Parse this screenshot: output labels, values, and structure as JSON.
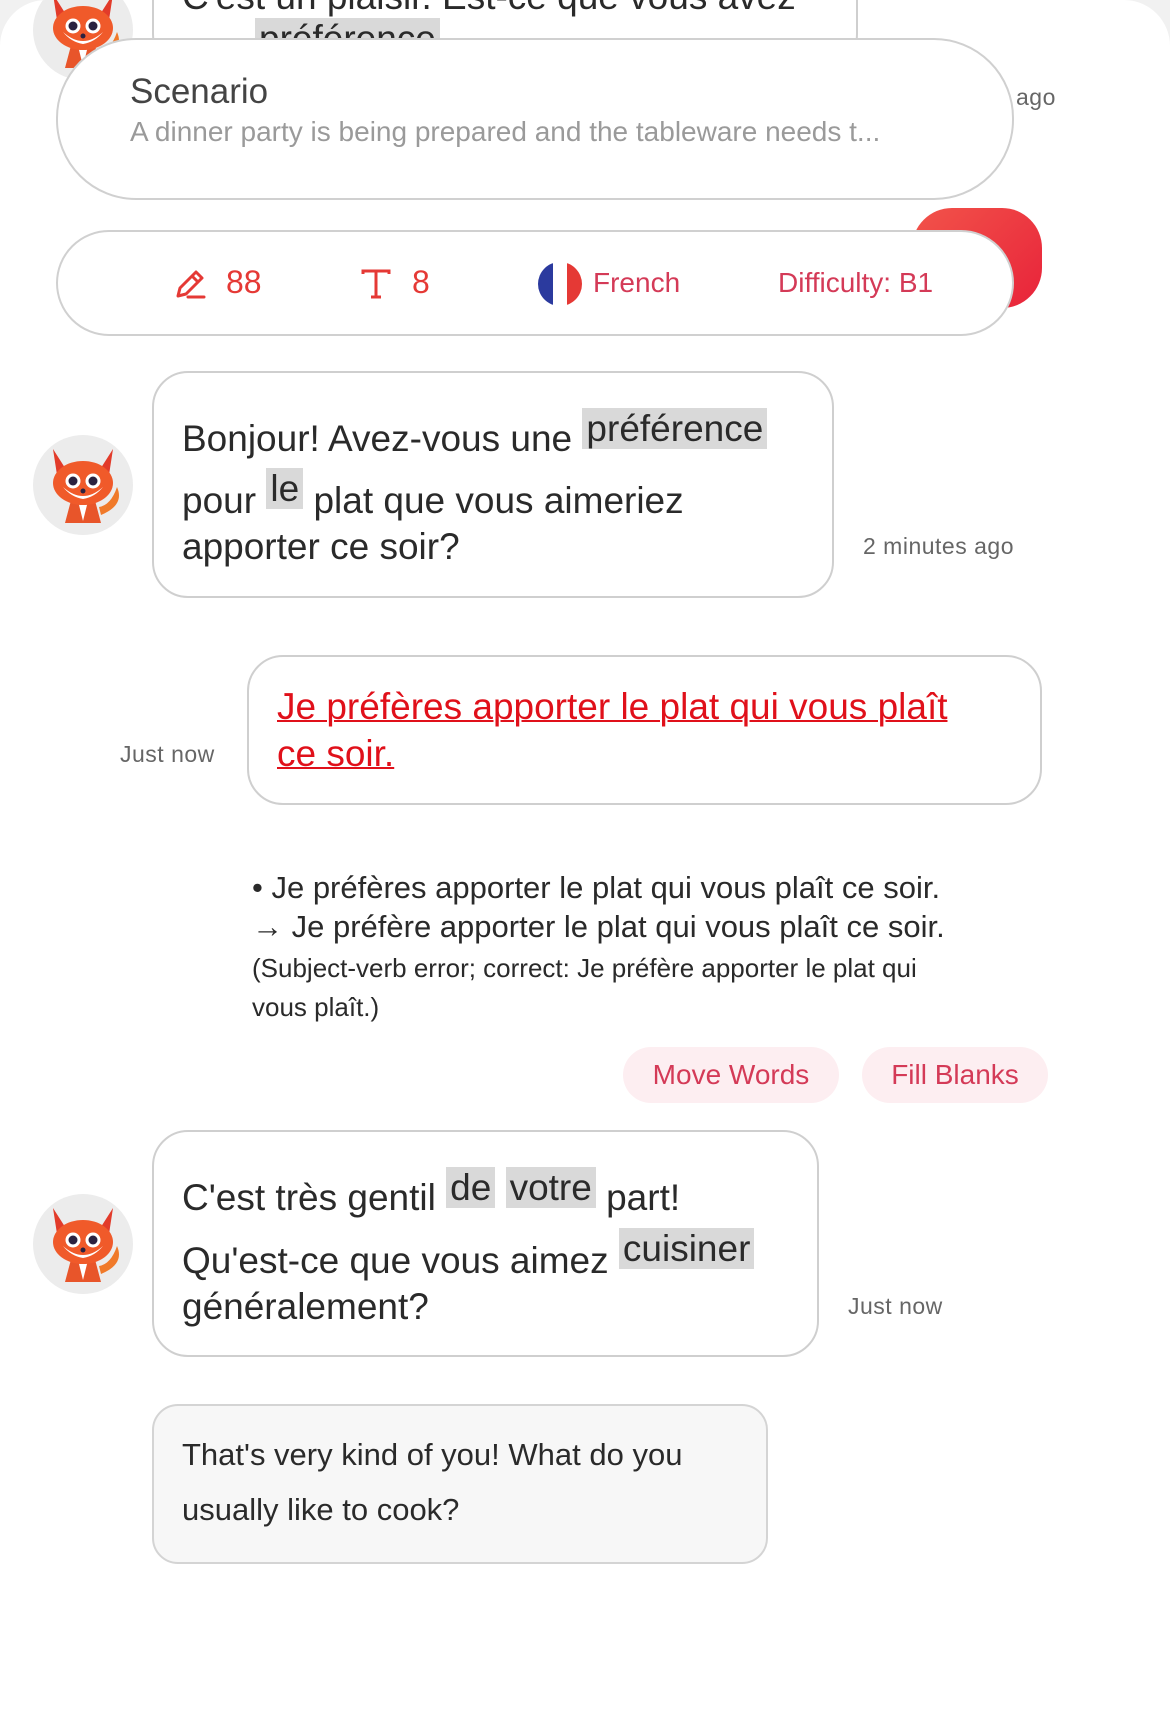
{
  "top_partial": {
    "text": "C'est un plaisir. Est-ce que vous avez",
    "word": "préférence",
    "timestamp": "ago"
  },
  "scenario": {
    "title": "Scenario",
    "subtitle": "A dinner party is being prepared and the tableware needs t..."
  },
  "stats": {
    "edits_icon": "pencil-icon",
    "edits": "88",
    "text_icon": "text-icon",
    "text_count": "8",
    "flag_icon": "france-flag-icon",
    "language": "French",
    "difficulty": "Difficulty: B1"
  },
  "messages": [
    {
      "sender": "bot",
      "line1_pre": "Bonjour! Avez-vous une",
      "line1_hl": "préférence",
      "line2_pre": "pour",
      "line2_hl": "le",
      "line2_post": "plat que vous aimeriez",
      "line3": "apporter ce soir?",
      "timestamp": "2 minutes ago"
    },
    {
      "sender": "user",
      "line1": "Je préfères apporter le plat qui vous plaît",
      "line2": "ce soir.",
      "timestamp": "Just now",
      "correction": {
        "line1": "• Je préfères apporter le plat qui vous plaît ce soir.",
        "line2": "→ Je préfère apporter le plat qui vous plaît ce soir.",
        "note1": "(Subject-verb error; correct: Je préfère apporter le plat qui",
        "note2": "vous plaît.)"
      },
      "actions": [
        "Move Words",
        "Fill Blanks"
      ]
    },
    {
      "sender": "bot",
      "line1_pre": "C'est très gentil",
      "line1_hl1": "de",
      "line1_hl2": "votre",
      "line1_post": "part!",
      "line2_pre": "Qu'est-ce que vous aimez",
      "line2_hl": "cuisiner",
      "line3": "généralement?",
      "timestamp": "Just now",
      "translation": {
        "line1": "That's very kind of you! What do you",
        "line2": "usually like to cook?"
      }
    }
  ],
  "colors": {
    "accent_red": "#e53935",
    "error_red": "#e0101a",
    "chip_bg": "#fdeef1",
    "chip_text": "#d43a57",
    "highlight": "#d9d9d9"
  }
}
